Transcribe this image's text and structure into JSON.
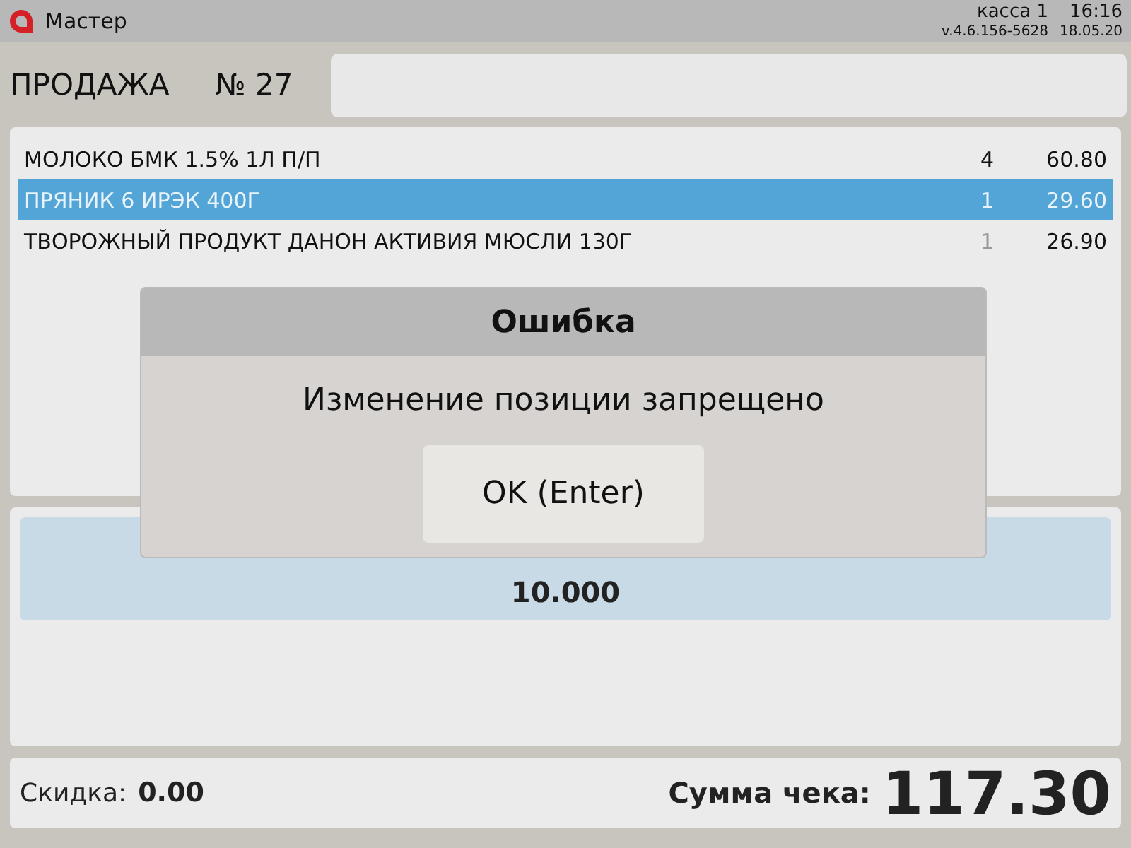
{
  "app_bar": {
    "title": "Мастер",
    "register": "касса 1",
    "version": "v.4.6.156-5628",
    "time": "16:16",
    "date": "18.05.20"
  },
  "sale": {
    "title": "ПРОДАЖА",
    "number": "№ 27"
  },
  "items": [
    {
      "name": "МОЛОКО БМК 1.5% 1Л П/П",
      "qty": "4",
      "sum": "60.80",
      "selected": false,
      "qty_muted": false
    },
    {
      "name": "ПРЯНИК 6 ИРЭК 400Г",
      "qty": "1",
      "sum": "29.60",
      "selected": true,
      "qty_muted": false
    },
    {
      "name": "ТВОРОЖНЫЙ ПРОДУКТ ДАНОН АКТИВИЯ МЮСЛИ 130Г",
      "qty": "1",
      "sum": "26.90",
      "selected": false,
      "qty_muted": true
    }
  ],
  "quantity": {
    "value": "10.000"
  },
  "footer": {
    "discount_label": "Скидка:",
    "discount": "0.00",
    "total_label": "Сумма чека:",
    "total": "117.30"
  },
  "dialog": {
    "title": "Ошибка",
    "message": "Изменение позиции запрещено",
    "button": "OK (Enter)"
  }
}
